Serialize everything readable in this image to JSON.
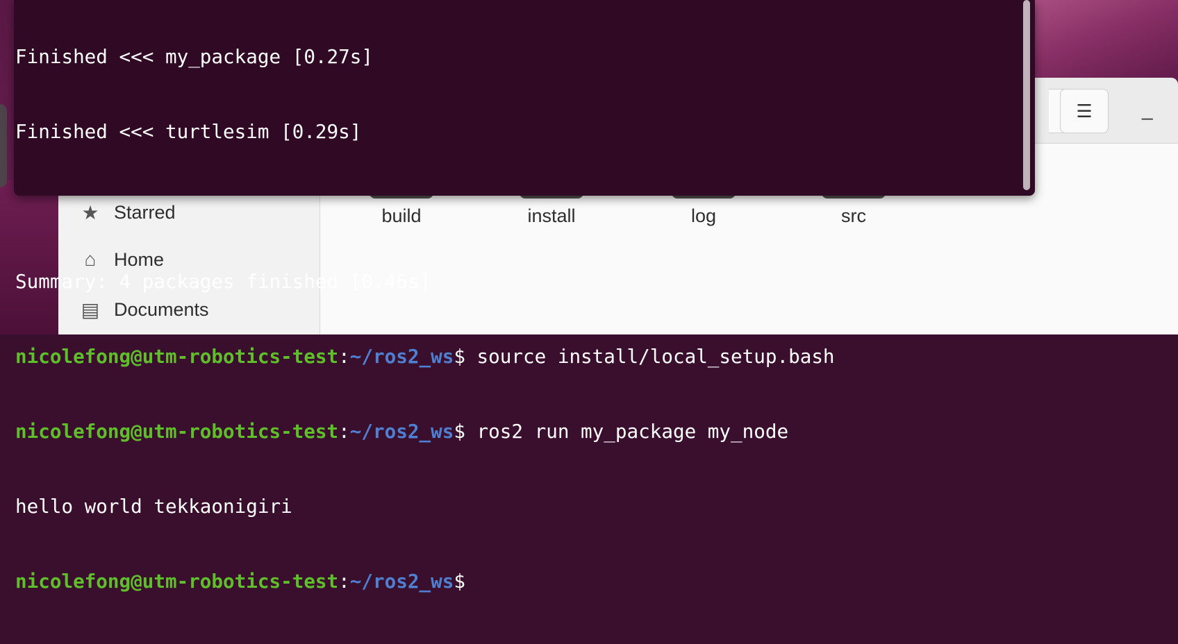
{
  "terminal": {
    "lines": [
      {
        "text": "Finished <<< my_package [0.27s]"
      },
      {
        "text": "Finished <<< turtlesim [0.29s]"
      },
      {
        "text": ""
      },
      {
        "text": "Summary: 4 packages finished [0.46s]"
      },
      {
        "user": "nicolefong@utm-robotics-test",
        "path": "~/ros2_ws",
        "command": "source install/local_setup.bash"
      },
      {
        "user": "nicolefong@utm-robotics-test",
        "path": "~/ros2_ws",
        "command": "ros2 run my_package my_node"
      },
      {
        "text": "hello world tekkaonigiri"
      },
      {
        "user": "nicolefong@utm-robotics-test",
        "path": "~/ros2_ws",
        "command": ""
      }
    ],
    "colors": {
      "background": "#300a24",
      "user": "#5fbf2a",
      "path": "#4f7fd1",
      "text": "#ffffff"
    }
  },
  "files": {
    "header": {
      "dropdown_icon": "chevron-down-icon",
      "menu_icon": "hamburger-menu-icon",
      "minimize_icon": "minimize-icon"
    },
    "sidebar": {
      "items": [
        {
          "label": "Starred",
          "icon": "star-icon"
        },
        {
          "label": "Home",
          "icon": "home-icon"
        },
        {
          "label": "Documents",
          "icon": "document-icon"
        }
      ]
    },
    "folders": [
      {
        "label": "build"
      },
      {
        "label": "install"
      },
      {
        "label": "log"
      },
      {
        "label": "src"
      }
    ]
  }
}
